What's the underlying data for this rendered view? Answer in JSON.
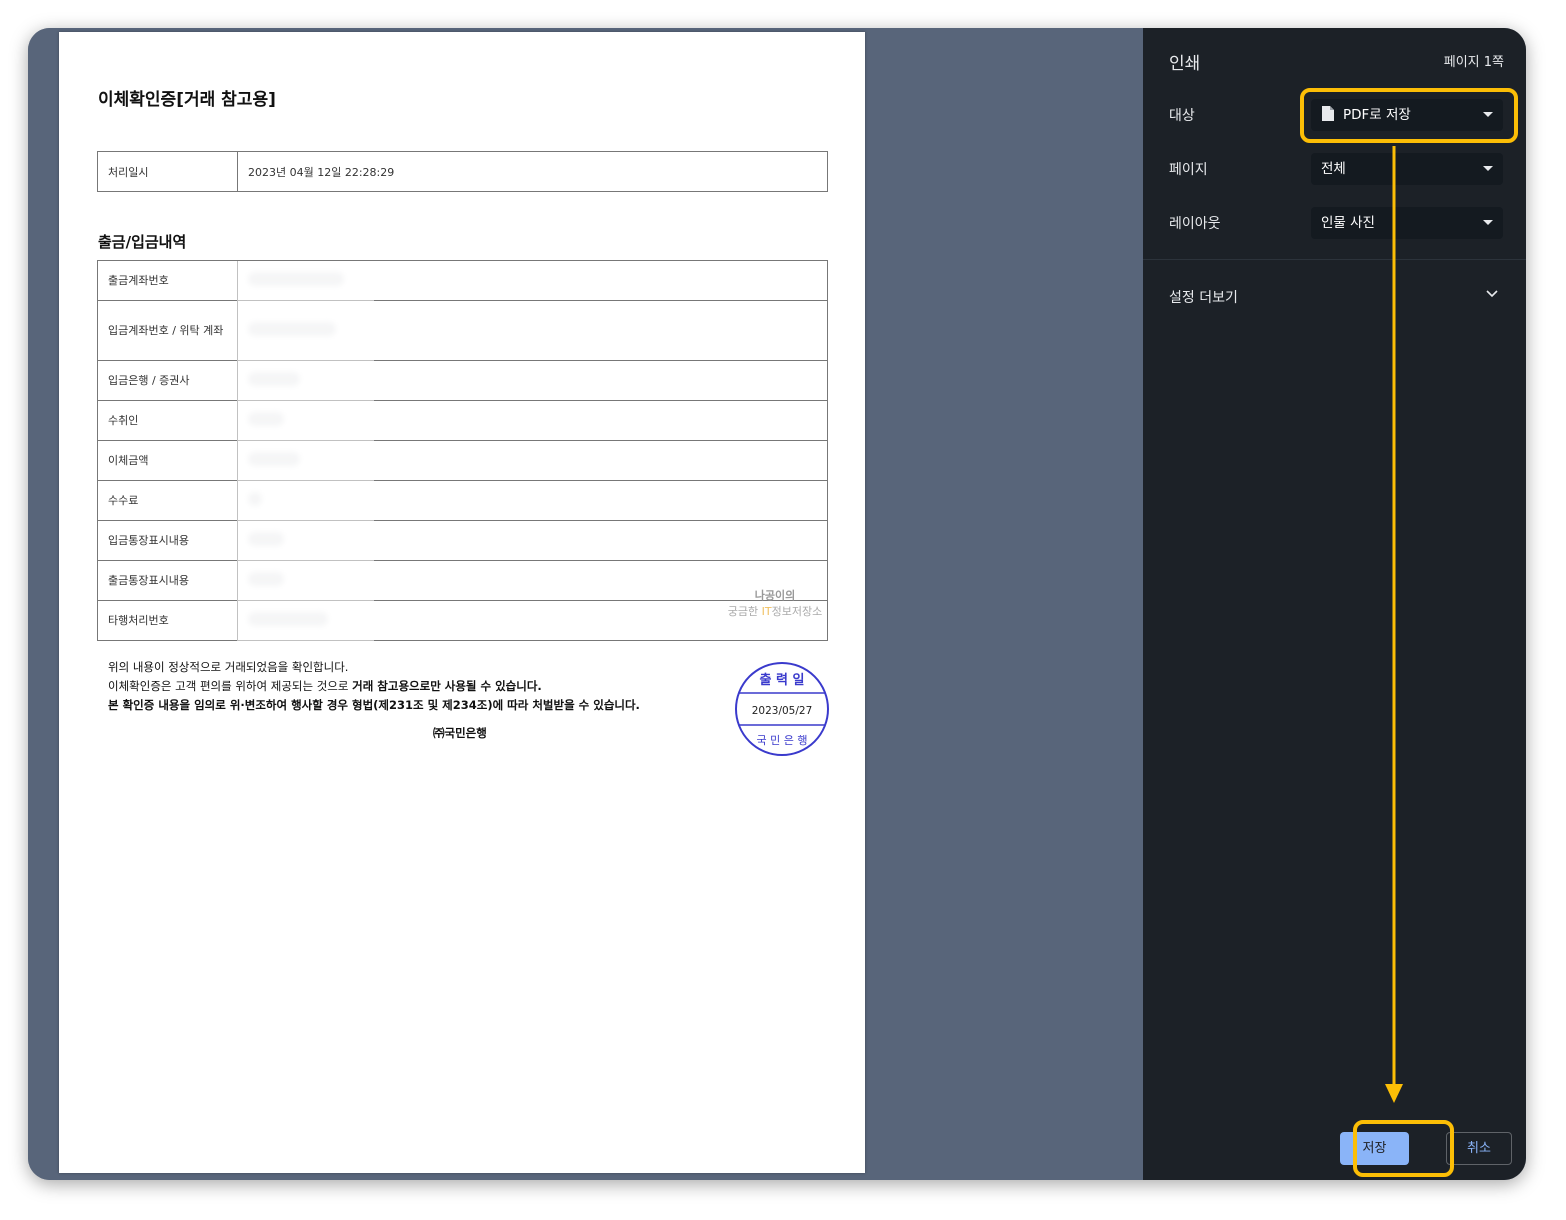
{
  "document": {
    "title": "이체확인증[거래 참고용]",
    "processing": {
      "label": "처리일시",
      "value": "2023년 04월 12일   22:28:29"
    },
    "section_title": "출금/입금내역",
    "rows": [
      {
        "label": "출금계좌번호"
      },
      {
        "label": "입금계좌번호 / 위탁 계좌"
      },
      {
        "label": "입금은행 / 증권사"
      },
      {
        "label": "수취인"
      },
      {
        "label": "이체금액"
      },
      {
        "label": "수수료"
      },
      {
        "label": "입금통장표시내용"
      },
      {
        "label": "출금통장표시내용"
      },
      {
        "label": "타행처리번호"
      }
    ],
    "notice_line1": "위의 내용이 정상적으로 거래되었음을 확인합니다.",
    "notice_line2_plain": "이체확인증은 고객 편의를 위하여 제공되는 것으로 ",
    "notice_line2_bold": "거래 참고용으로만 사용될 수 있습니다.",
    "notice_line3": "본 확인증 내용을 임의로 위·변조하여 행사할 경우 형법(제231조 및 제234조)에 따라 처벌받을 수 있습니다.",
    "bank_name": "㈜국민은행",
    "stamp": {
      "top": "출 력 일",
      "date": "2023/05/27",
      "bottom": "국 민 은 행"
    },
    "watermark_line1": "나공이의",
    "watermark_line2_a": "궁금한 ",
    "watermark_line2_it": "IT",
    "watermark_line2_b": "정보저장소"
  },
  "print_panel": {
    "title": "인쇄",
    "page_count": "페이지 1쪽",
    "destination": {
      "label": "대상",
      "value": "PDF로 저장",
      "icon": "file-icon"
    },
    "pages": {
      "label": "페이지",
      "value": "전체"
    },
    "layout": {
      "label": "레이아웃",
      "value": "인물 사진"
    },
    "more_settings": "설정 더보기",
    "save_button": "저장",
    "cancel_button": "취소"
  },
  "colors": {
    "highlight": "#fcbe06",
    "panel_bg": "#1c2127",
    "preview_bg": "#58657a",
    "save_button": "#8ab4f8",
    "stamp": "#3a3acc"
  }
}
